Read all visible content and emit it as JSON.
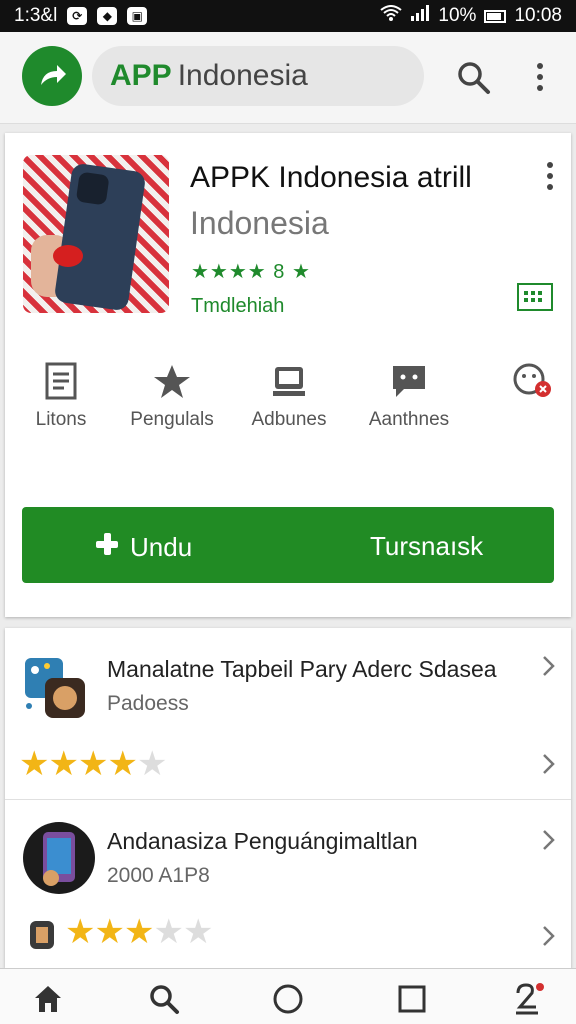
{
  "status_bar": {
    "time_left": "1:3&l",
    "battery": "10%",
    "time_right": "10:08"
  },
  "app_bar": {
    "search_accent": "APP",
    "search_text": "Indonesia"
  },
  "app": {
    "title": "APPK Indonesia atrill",
    "subtitle": "Indonesia",
    "rating_label": "★★★★ 8 ★",
    "developer": "Tmdlehiah",
    "colors": {
      "accent": "#1f8a2c",
      "button": "#218b24",
      "star": "#f2b516"
    }
  },
  "actions": [
    {
      "label": "Litons",
      "icon": "document-icon"
    },
    {
      "label": "Pengulals",
      "icon": "star-icon"
    },
    {
      "label": "Adbunes",
      "icon": "media-icon"
    },
    {
      "label": "Aanthnes",
      "icon": "chat-icon"
    },
    {
      "label": "",
      "icon": "profile-badge-icon"
    }
  ],
  "install_button": {
    "left_label": "Undu",
    "right_label": "Tursnaısk"
  },
  "list": [
    {
      "name": "Manalatne Tapbeil Pary Aderc Sdasea",
      "meta": "Padoess",
      "rating": 3.5
    },
    {
      "name": "Andanasiza Penguángimaltlan",
      "meta": "2000 A1P8",
      "rating": 2.5
    }
  ],
  "bottom_nav": [
    "home-icon",
    "search-icon",
    "circle-icon",
    "square-icon",
    "person-icon"
  ]
}
